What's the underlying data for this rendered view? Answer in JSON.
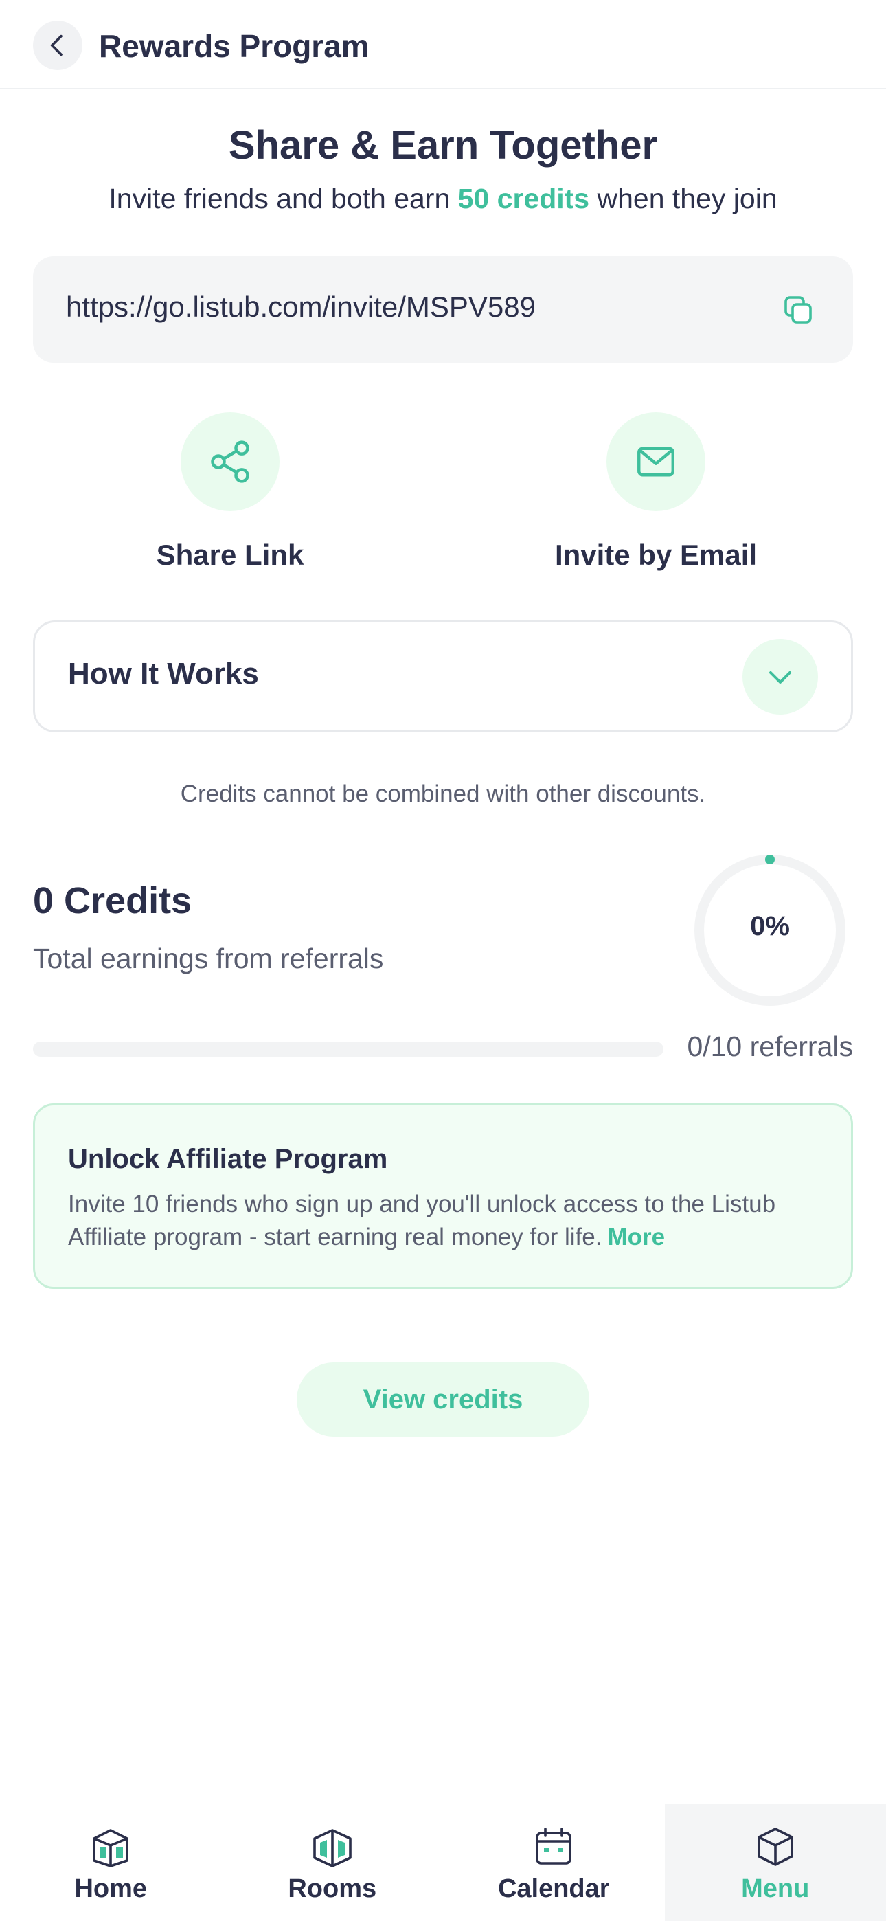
{
  "header": {
    "title": "Rewards Program",
    "back_icon": "chevron-left-icon"
  },
  "hero": {
    "title": "Share & Earn Together",
    "subtitle_before": "Invite friends and both earn ",
    "subtitle_highlight": "50 credits",
    "subtitle_after": " when they join"
  },
  "invite": {
    "link": "https://go.listub.com/invite/MSPV589",
    "copy_icon": "copy-icon"
  },
  "actions": [
    {
      "label": "Share Link",
      "icon": "share-icon"
    },
    {
      "label": "Invite by Email",
      "icon": "mail-icon"
    }
  ],
  "how_it_works": {
    "title": "How It Works",
    "icon": "chevron-down-icon"
  },
  "note": "Credits cannot be combined with other discounts.",
  "credits": {
    "value": "0 Credits",
    "subtitle": "Total earnings from referrals",
    "percent_label": "0%",
    "progress_fraction": 0,
    "progress_text": "0/10 referrals"
  },
  "affiliate": {
    "title": "Unlock Affiliate Program",
    "text": "Invite 10 friends who sign up and you'll unlock access to the Listub Affiliate program - start earning real money for life.",
    "more": "More"
  },
  "view_button": "View credits",
  "colors": {
    "accent": "#3fbf9c",
    "accent_bg": "#e9fbee",
    "text": "#2b2f4a",
    "muted": "#5a5e70"
  },
  "nav": [
    {
      "label": "Home",
      "icon": "home-icon",
      "active": false
    },
    {
      "label": "Rooms",
      "icon": "rooms-icon",
      "active": false
    },
    {
      "label": "Calendar",
      "icon": "calendar-icon",
      "active": false
    },
    {
      "label": "Menu",
      "icon": "menu-icon",
      "active": true
    }
  ]
}
